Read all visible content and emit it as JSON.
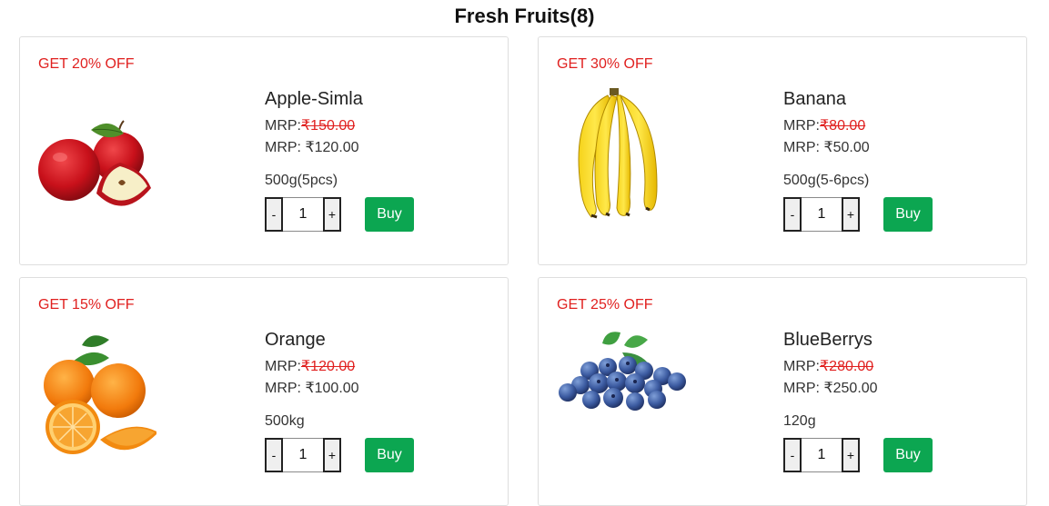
{
  "title": "Fresh Fruits(8)",
  "products": [
    {
      "discount": "GET 20% OFF",
      "image": "apple-image",
      "name": "Apple-Simla",
      "mrp_label": "MRP:",
      "mrp_old": "₹150.00",
      "mrp_new": "MRP: ₹120.00",
      "weight": "500g(5pcs)",
      "qty_minus": "-",
      "qty": "1",
      "qty_plus": "+",
      "buy": "Buy"
    },
    {
      "discount": "GET 30% OFF",
      "image": "banana-image",
      "name": "Banana",
      "mrp_label": "MRP:",
      "mrp_old": "₹80.00",
      "mrp_new": "MRP: ₹50.00",
      "weight": "500g(5-6pcs)",
      "qty_minus": "-",
      "qty": "1",
      "qty_plus": "+",
      "buy": "Buy"
    },
    {
      "discount": "GET 15% OFF",
      "image": "orange-image",
      "name": "Orange",
      "mrp_label": "MRP:",
      "mrp_old": "₹120.00",
      "mrp_new": "MRP: ₹100.00",
      "weight": "500kg",
      "qty_minus": "-",
      "qty": "1",
      "qty_plus": "+",
      "buy": "Buy"
    },
    {
      "discount": "GET 25% OFF",
      "image": "blueberry-image",
      "name": "BlueBerrys",
      "mrp_label": "MRP:",
      "mrp_old": "₹280.00",
      "mrp_new": "MRP: ₹250.00",
      "weight": "120g",
      "qty_minus": "-",
      "qty": "1",
      "qty_plus": "+",
      "buy": "Buy"
    }
  ],
  "colors": {
    "discount": "#e0201f",
    "buy_button": "#0ca651"
  }
}
